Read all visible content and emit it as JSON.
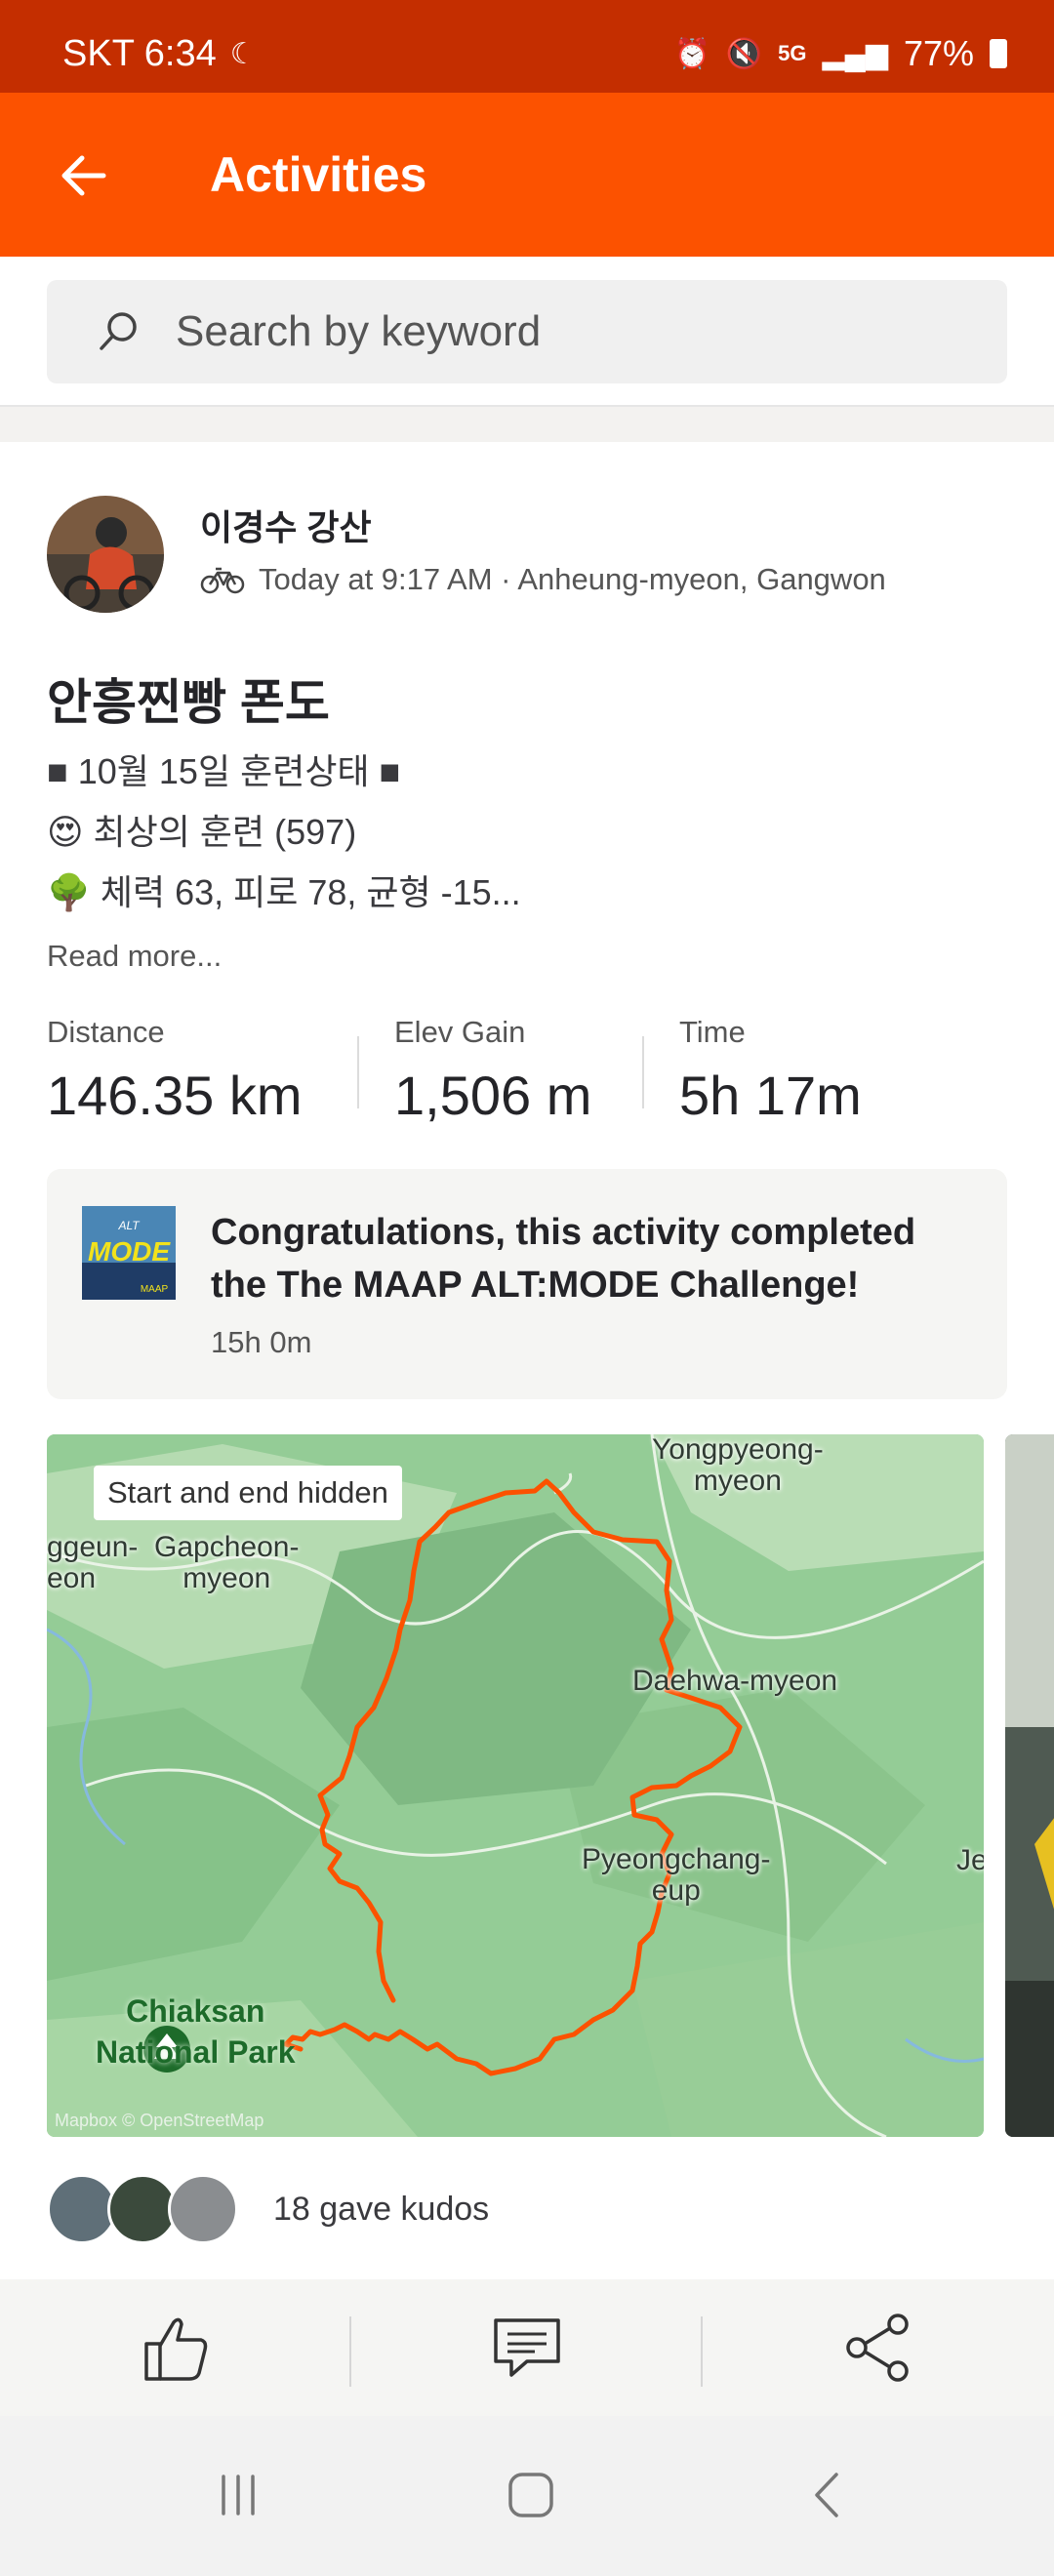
{
  "status_bar": {
    "carrier_time": "SKT 6:34",
    "battery": "77%",
    "icons": [
      "moon-icon",
      "alarm-icon",
      "mute-icon",
      "5g-icon",
      "signal-icon",
      "battery-icon"
    ]
  },
  "header": {
    "title": "Activities"
  },
  "search": {
    "placeholder": "Search by keyword"
  },
  "activity": {
    "athlete": "이경수 강산",
    "meta": "Today at 9:17 AM · Anheung-myeon, Gangwon",
    "title": "안흥찐빵 폰도",
    "description": [
      "■ 10월 15일 훈련상태 ■",
      "😍 최상의 훈련 (597)",
      "🌳 체력 63, 피로 78, 균형 -15..."
    ],
    "read_more": "Read more...",
    "stats": [
      {
        "label": "Distance",
        "value": "146.35 km"
      },
      {
        "label": "Elev Gain",
        "value": "1,506 m"
      },
      {
        "label": "Time",
        "value": "5h 17m"
      }
    ]
  },
  "challenge": {
    "text": "Congratulations, this activity completed the The MAAP ALT:MODE Challenge!",
    "time": "15h 0m",
    "badge": {
      "top": "ALT",
      "main": "MODE",
      "foot": "MAAP"
    }
  },
  "map": {
    "chip": "Start and end hidden",
    "labels": [
      "Yongpyeong-\nmyeon",
      "Gapcheon-\nmyeon",
      "ggeun-\neon",
      "Daehwa-myeon",
      "Pyeongchang-\neup",
      "Je"
    ],
    "park": "Chiaksan\nNational Park",
    "attribution": "Mapbox © OpenStreetMap"
  },
  "kudos": {
    "text": "18 gave kudos"
  },
  "colors": {
    "brand": "#fc5200",
    "status_bar": "#c42e00",
    "route": "#fc5200"
  }
}
